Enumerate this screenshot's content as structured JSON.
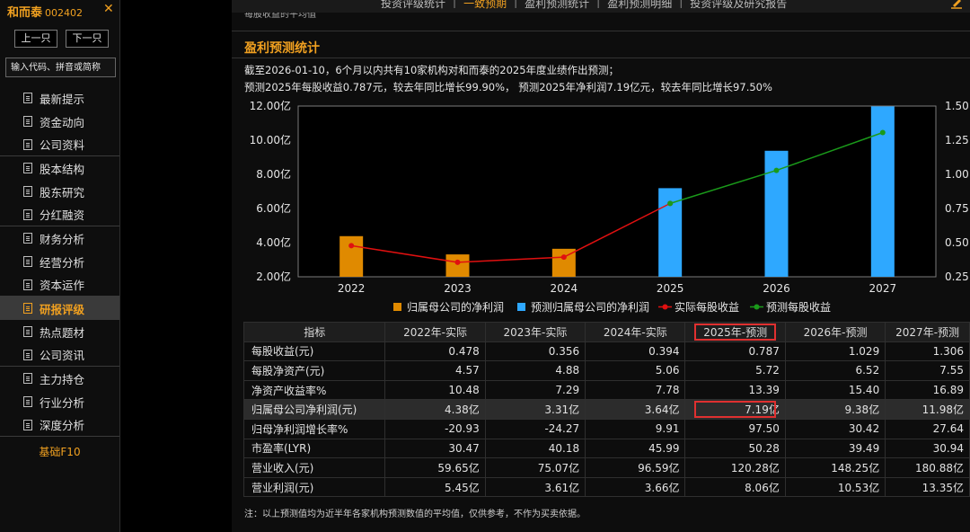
{
  "stock": {
    "name": "和而泰",
    "code": "002402",
    "close": "✕"
  },
  "nav": {
    "prev": "上一只",
    "next": "下一只"
  },
  "search": {
    "placeholder": "输入代码、拼音或简称"
  },
  "menu": [
    {
      "label": "最新提示",
      "icon": "document-icon"
    },
    {
      "label": "资金动向",
      "icon": "document-icon"
    },
    {
      "label": "公司资料",
      "icon": "document-icon"
    },
    {
      "label": "股本结构",
      "icon": "document-icon"
    },
    {
      "label": "股东研究",
      "icon": "document-icon"
    },
    {
      "label": "分红融资",
      "icon": "document-icon"
    },
    {
      "label": "财务分析",
      "icon": "document-icon"
    },
    {
      "label": "经营分析",
      "icon": "document-icon"
    },
    {
      "label": "资本运作",
      "icon": "document-icon"
    },
    {
      "label": "研报评级",
      "icon": "document-icon",
      "active": true
    },
    {
      "label": "热点题材",
      "icon": "document-icon"
    },
    {
      "label": "公司资讯",
      "icon": "document-icon"
    },
    {
      "label": "主力持仓",
      "icon": "document-icon"
    },
    {
      "label": "行业分析",
      "icon": "document-icon"
    },
    {
      "label": "深度分析",
      "icon": "document-icon"
    }
  ],
  "f10": "基础F10",
  "tabs": [
    {
      "label": "投资评级统计"
    },
    {
      "label": "一致预期",
      "active": true
    },
    {
      "label": "盈利预测统计"
    },
    {
      "label": "盈利预测明细"
    },
    {
      "label": "投资评级及研究报告"
    }
  ],
  "prev_section_title": "每股收益的平均值",
  "section": {
    "title": "盈利预测统计",
    "summary1": "截至2026-01-10，6个月以内共有10家机构对和而泰的2025年度业绩作出预测；",
    "summary2": "预测2025年每股收益0.787元，较去年同比增长99.90%， 预测2025年净利润7.19亿元，较去年同比增长97.50%"
  },
  "chart_data": {
    "type": "bar",
    "categories": [
      "2022",
      "2023",
      "2024",
      "2025",
      "2026",
      "2027"
    ],
    "y_left": {
      "ticks": [
        "2.00亿",
        "4.00亿",
        "6.00亿",
        "8.00亿",
        "10.00亿",
        "12.00亿"
      ],
      "ylim": [
        2,
        12
      ]
    },
    "y_right": {
      "ticks": [
        "0.25",
        "0.50",
        "0.75",
        "1.00",
        "1.25",
        "1.50"
      ],
      "ylim": [
        0.25,
        1.5
      ]
    },
    "series": [
      {
        "name": "归属母公司的净利润",
        "kind": "bar",
        "axis": "left",
        "color": "#e08a00",
        "values": [
          4.38,
          3.31,
          3.64,
          null,
          null,
          null
        ]
      },
      {
        "name": "预测归属母公司的净利润",
        "kind": "bar",
        "axis": "left",
        "color": "#2ea8ff",
        "values": [
          null,
          null,
          null,
          7.19,
          9.38,
          11.98
        ]
      },
      {
        "name": "实际每股收益",
        "kind": "line",
        "axis": "right",
        "color": "#e01010",
        "values": [
          0.478,
          0.356,
          0.394,
          0.787,
          null,
          null
        ]
      },
      {
        "name": "预测每股收益",
        "kind": "line",
        "axis": "right",
        "color": "#1a9a1a",
        "values": [
          null,
          null,
          null,
          0.787,
          1.029,
          1.306
        ]
      }
    ],
    "legend_position": "bottom",
    "grid": false
  },
  "table": {
    "headers": [
      "指标",
      "2022年-实际",
      "2023年-实际",
      "2024年-实际",
      "2025年-预测",
      "2026年-预测",
      "2027年-预测"
    ],
    "rows": [
      [
        "每股收益(元)",
        "0.478",
        "0.356",
        "0.394",
        "0.787",
        "1.029",
        "1.306"
      ],
      [
        "每股净资产(元)",
        "4.57",
        "4.88",
        "5.06",
        "5.72",
        "6.52",
        "7.55"
      ],
      [
        "净资产收益率%",
        "10.48",
        "7.29",
        "7.78",
        "13.39",
        "15.40",
        "16.89"
      ],
      [
        "归属母公司净利润(元)",
        "4.38亿",
        "3.31亿",
        "3.64亿",
        "7.19亿",
        "9.38亿",
        "11.98亿"
      ],
      [
        "归母净利润增长率%",
        "-20.93",
        "-24.27",
        "9.91",
        "97.50",
        "30.42",
        "27.64"
      ],
      [
        "市盈率(LYR)",
        "30.47",
        "40.18",
        "45.99",
        "50.28",
        "39.49",
        "30.94"
      ],
      [
        "营业收入(元)",
        "59.65亿",
        "75.07亿",
        "96.59亿",
        "120.28亿",
        "148.25亿",
        "180.88亿"
      ],
      [
        "营业利润(元)",
        "5.45亿",
        "3.61亿",
        "3.66亿",
        "8.06亿",
        "10.53亿",
        "13.35亿"
      ]
    ],
    "highlight_row": 3
  },
  "note": "注：以上预测值均为近半年各家机构预测数值的平均值，仅供参考，不作为买卖依据。"
}
